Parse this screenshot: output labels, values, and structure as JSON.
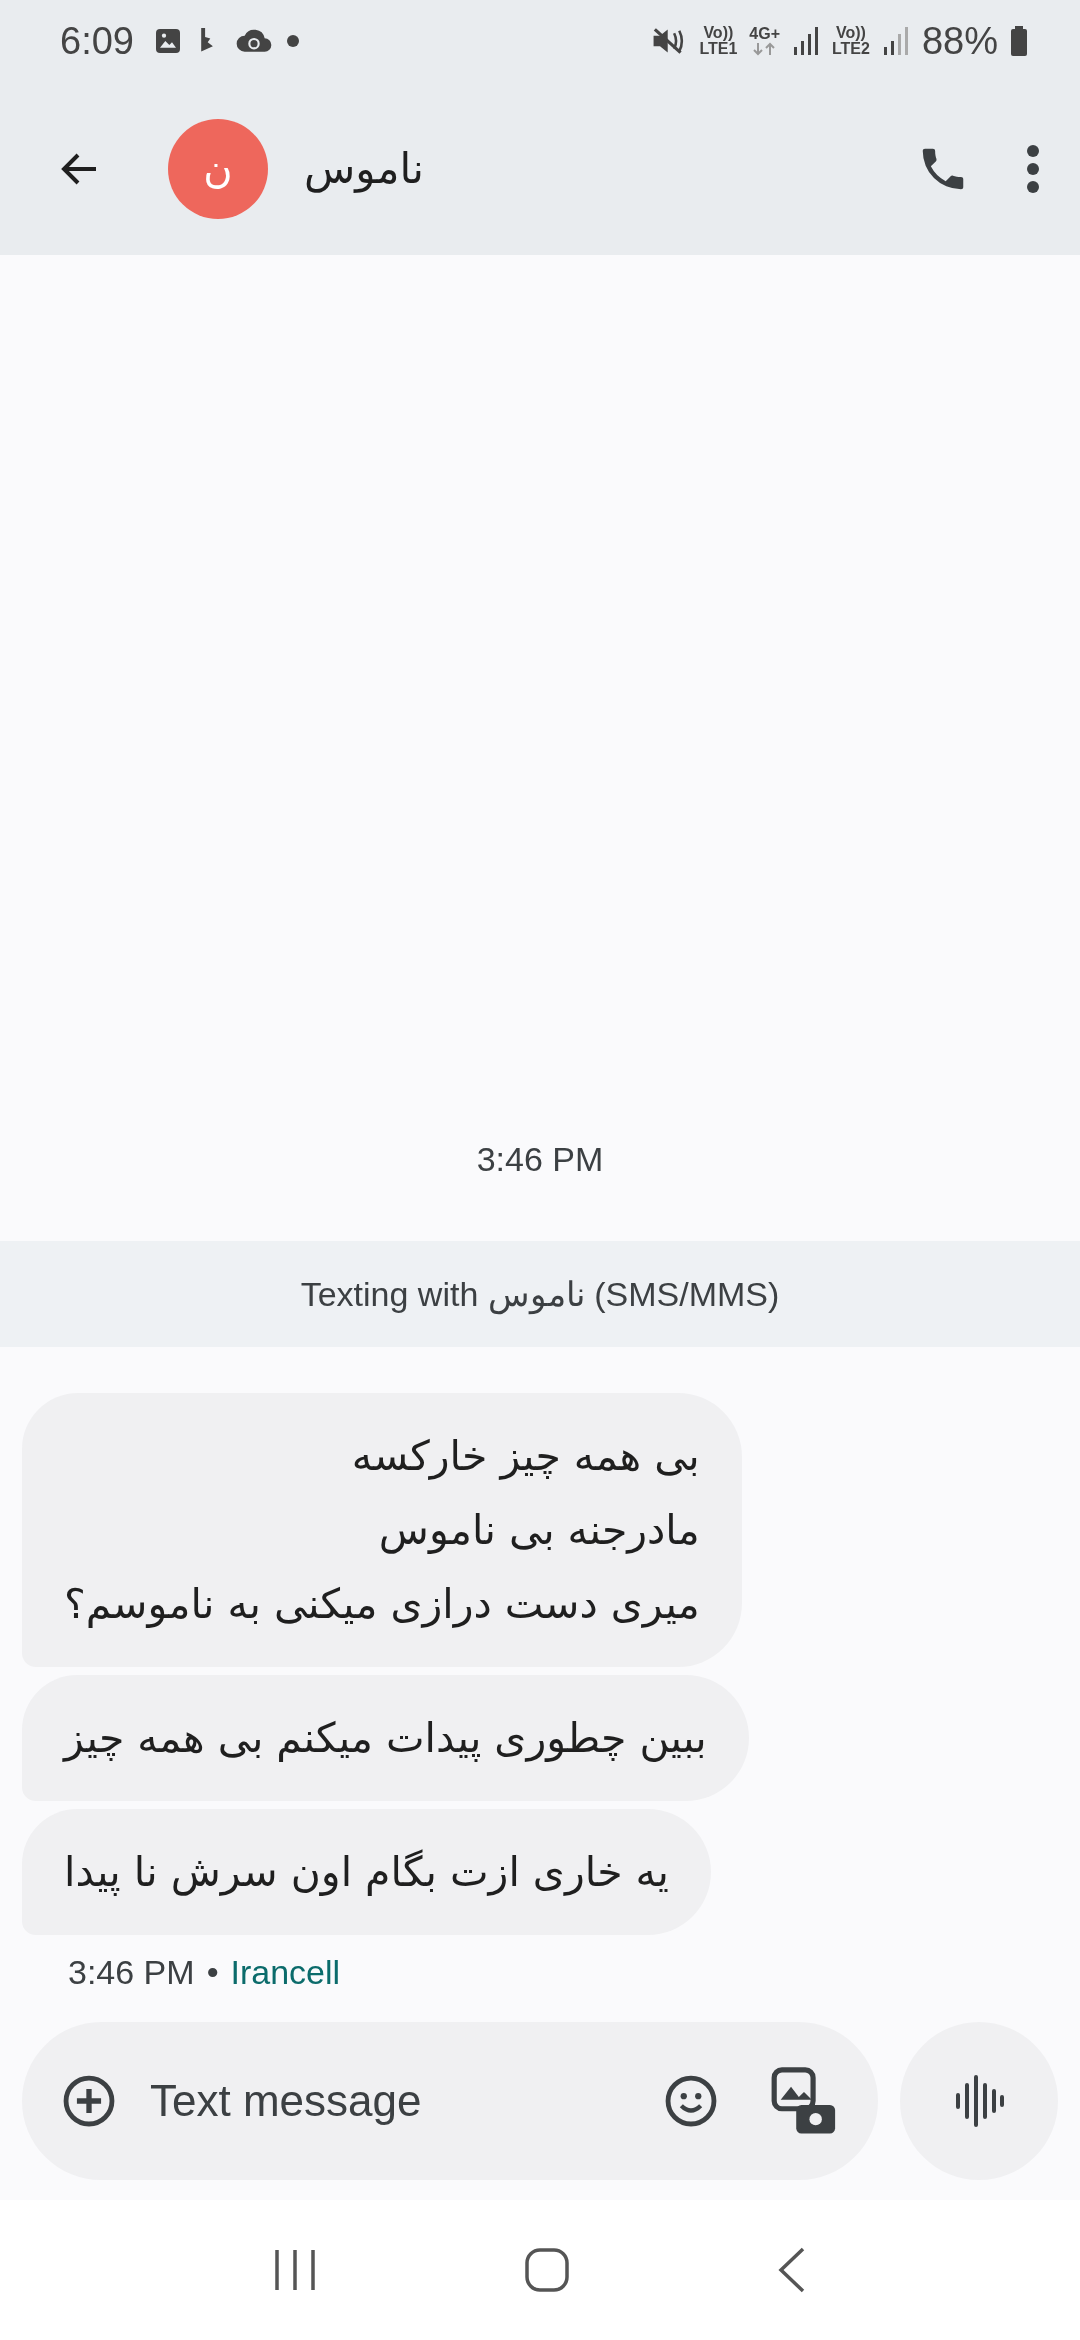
{
  "status_bar": {
    "time": "6:09",
    "sim1": {
      "volte": "Vo))",
      "label": "LTE1"
    },
    "network": "4G+",
    "sim2": {
      "volte": "Vo))",
      "label": "LTE2"
    },
    "battery": "88%"
  },
  "header": {
    "avatar_letter": "ن",
    "name": "ناموس"
  },
  "conversation": {
    "timestamp": "3:46 PM",
    "banner": "Texting with ناموس (SMS/MMS)",
    "messages": [
      {
        "text": "بی همه چیز خارکسه\nمادرجنه بی ناموس\nمیری دست درازی میکنی به ناموسم؟"
      },
      {
        "text": "ببین چطوری پیدات میکنم بی همه چیز"
      },
      {
        "text": "یه خاری ازت بگام اون سرش نا پیدا"
      }
    ],
    "meta": {
      "time": "3:46 PM",
      "separator": "•",
      "carrier": "Irancell"
    }
  },
  "composer": {
    "placeholder": "Text message"
  }
}
